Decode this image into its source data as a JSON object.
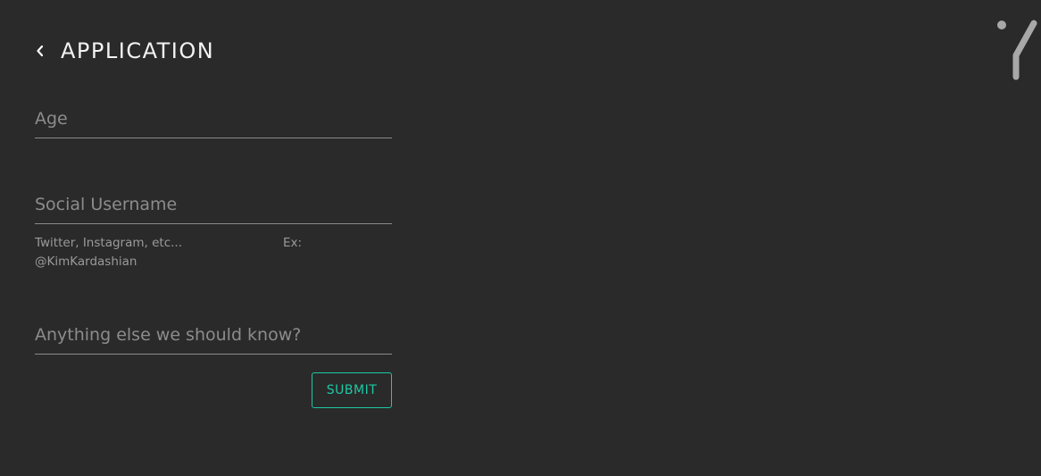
{
  "header": {
    "title": "APPLICATION",
    "back_icon": "chevron-left-icon"
  },
  "logo": {
    "icon": "brand-logo-icon",
    "color": "#a8a8a8"
  },
  "form": {
    "age": {
      "placeholder": "Age",
      "value": ""
    },
    "social_username": {
      "placeholder": "Social Username",
      "value": "",
      "hint": "Twitter, Instagram, etc...",
      "example_label": "Ex:",
      "example_value": "@KimKardashian"
    },
    "notes": {
      "placeholder": "Anything else we should know?",
      "value": ""
    },
    "submit_label": "SUBMIT"
  },
  "colors": {
    "background": "#2a2a2a",
    "accent": "#1ec9a4",
    "underline": "#8a8a8a",
    "placeholder": "#8c8c8c"
  }
}
